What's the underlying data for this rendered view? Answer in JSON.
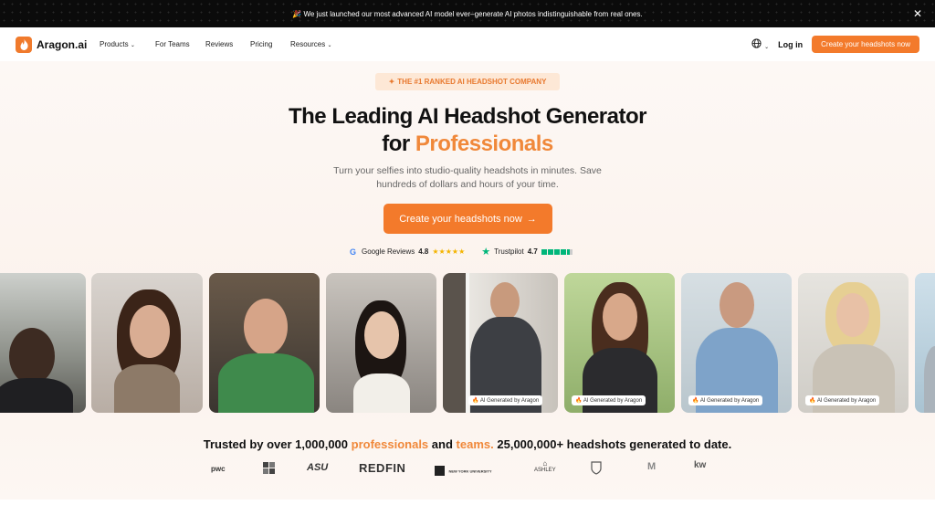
{
  "announcement": {
    "emoji": "🎉",
    "text": "We just launched our most advanced AI model ever–generate AI photos indistinguishable from real ones.",
    "close": "✕"
  },
  "nav": {
    "logo_text": "Aragon.ai",
    "menu": [
      "Products",
      "For Teams",
      "Reviews",
      "Pricing",
      "Resources"
    ],
    "login": "Log in",
    "cta": "Create your headshots now"
  },
  "hero": {
    "pill": "THE #1 RANKED AI HEADSHOT COMPANY",
    "title_line1": "The Leading AI Headshot Generator",
    "title_line2_prefix": "for",
    "title_line2_accent": "Professionals",
    "subtitle_line1": "Turn your selfies into studio-quality headshots in minutes. Save",
    "subtitle_line2": "hundreds of dollars and hours of your time.",
    "cta": "Create your headshots now",
    "cta_arrow": "→"
  },
  "ratings": {
    "google_label": "Google Reviews",
    "google_score": "4.8",
    "google_stars": "★★★★★",
    "trustpilot_label": "Trustpilot",
    "trustpilot_score": "4.7"
  },
  "photos": {
    "badge_text": "AI Generated by Aragon"
  },
  "trusted": {
    "prefix": "Trusted by over 1,000,000",
    "accent1": "professionals",
    "middle": "and",
    "accent2": "teams.",
    "suffix": "25,000,000+ headshots generated to date."
  },
  "brands": [
    "pwc",
    "ASU",
    "REDFIN",
    "NEW YORK UNIVERSITY",
    "ASHLEY",
    "M",
    "kw"
  ],
  "colors": {
    "accent": "#f37a2b",
    "accent_text": "#f0883a",
    "pill_bg": "#fde8d6"
  }
}
